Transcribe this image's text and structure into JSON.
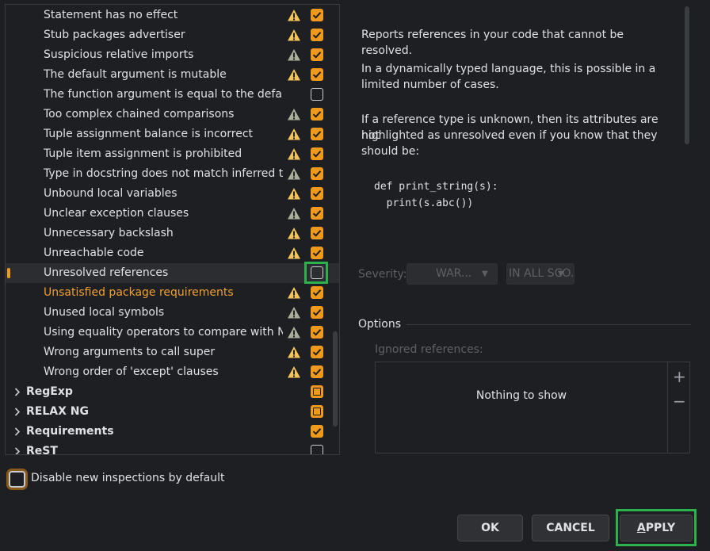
{
  "inspections": [
    {
      "label": "Statement has no effect",
      "icon": "warning-icon",
      "icon_color": "#f2c55c",
      "checked": true
    },
    {
      "label": "Stub packages advertiser",
      "icon": "warning-icon",
      "icon_color": "#f2c55c",
      "checked": true
    },
    {
      "label": "Suspicious relative imports",
      "icon": "weak-warning-icon",
      "icon_color": "#a9b09a",
      "checked": true
    },
    {
      "label": "The default argument is mutable",
      "icon": "warning-icon",
      "icon_color": "#f2c55c",
      "checked": true
    },
    {
      "label": "The function argument is equal to the default",
      "icon": "",
      "icon_color": "",
      "checked": false
    },
    {
      "label": "Too complex chained comparisons",
      "icon": "weak-warning-icon",
      "icon_color": "#a9b09a",
      "checked": true
    },
    {
      "label": "Tuple assignment balance is incorrect",
      "icon": "warning-icon",
      "icon_color": "#f2c55c",
      "checked": true
    },
    {
      "label": "Tuple item assignment is prohibited",
      "icon": "warning-icon",
      "icon_color": "#f2c55c",
      "checked": true
    },
    {
      "label": "Type in docstring does not match inferred typ",
      "icon": "weak-warning-icon",
      "icon_color": "#a9b09a",
      "checked": true
    },
    {
      "label": "Unbound local variables",
      "icon": "warning-icon",
      "icon_color": "#f2c55c",
      "checked": true
    },
    {
      "label": "Unclear exception clauses",
      "icon": "weak-warning-icon",
      "icon_color": "#a9b09a",
      "checked": true
    },
    {
      "label": "Unnecessary backslash",
      "icon": "warning-icon",
      "icon_color": "#f2c55c",
      "checked": true
    },
    {
      "label": "Unreachable code",
      "icon": "warning-icon",
      "icon_color": "#f2c55c",
      "checked": true
    },
    {
      "label": "Unresolved references",
      "icon": "",
      "icon_color": "",
      "checked": false,
      "selected": true
    },
    {
      "label": "Unsatisfied package requirements",
      "icon": "warning-icon",
      "icon_color": "#f2c55c",
      "checked": true,
      "modified": true
    },
    {
      "label": "Unused local symbols",
      "icon": "weak-warning-icon",
      "icon_color": "#a9b09a",
      "checked": true
    },
    {
      "label": "Using equality operators to compare with Nor",
      "icon": "weak-warning-icon",
      "icon_color": "#a9b09a",
      "checked": true
    },
    {
      "label": "Wrong arguments to call super",
      "icon": "warning-icon",
      "icon_color": "#f2c55c",
      "checked": true
    },
    {
      "label": "Wrong order of 'except' clauses",
      "icon": "warning-icon",
      "icon_color": "#f2c55c",
      "checked": true
    }
  ],
  "groups": [
    {
      "label": "RegExp",
      "state": "partial"
    },
    {
      "label": "RELAX NG",
      "state": "partial"
    },
    {
      "label": "Requirements",
      "state": "checked"
    },
    {
      "label": "ReST",
      "state": "unchecked"
    }
  ],
  "description": {
    "p1": "Reports references in your code that cannot be resolved.",
    "p2_line1": "In a dynamically typed language, this is possible in a",
    "p2_line2": "limited number of cases.",
    "p3_line1": "If a reference type is unknown, then its attributes are not",
    "p3_line2": "highlighted as unresolved even if you know that they",
    "p3_line3": "should be:",
    "code_line1": "def print_string(s):",
    "code_line2": "  print(s.abc())"
  },
  "severity": {
    "label": "Severity:",
    "value": "WAR...",
    "scope": "IN ALL SCO..."
  },
  "options": {
    "title": "Options",
    "ignored_label": "Ignored references:",
    "empty_text": "Nothing to show",
    "add_symbol": "+",
    "remove_symbol": "−"
  },
  "footer": {
    "disable_label": "Disable new inspections by default",
    "ok": "OK",
    "cancel": "CANCEL",
    "apply": "APPLY"
  },
  "colors": {
    "accent": "#f09a1b",
    "highlight": "#2bb24c",
    "modified_text": "#f0a030"
  }
}
